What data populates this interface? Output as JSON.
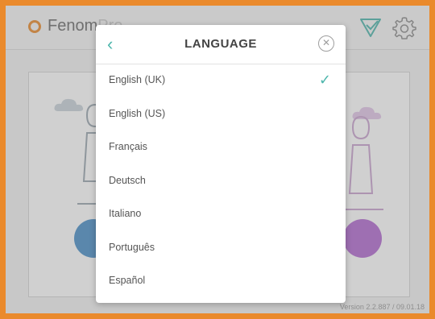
{
  "app": {
    "logo_text": "Fenom",
    "logo_text_suffix": "Pro",
    "version": "Version 2.2.887 / 09.01.18",
    "accent_color": "#ea8a2c"
  },
  "header": {
    "icons": [
      "checkbox-check-icon",
      "gear-icon"
    ]
  },
  "language_dialog": {
    "back_symbol": "‹",
    "title": "LANGUAGE",
    "close_symbol": "✕",
    "selected_check": "✓",
    "selected_index": 0,
    "accent_color": "#4db6ac",
    "languages": [
      "English (UK)",
      "English (US)",
      "Français",
      "Deutsch",
      "Italiano",
      "Português",
      "Español"
    ]
  }
}
